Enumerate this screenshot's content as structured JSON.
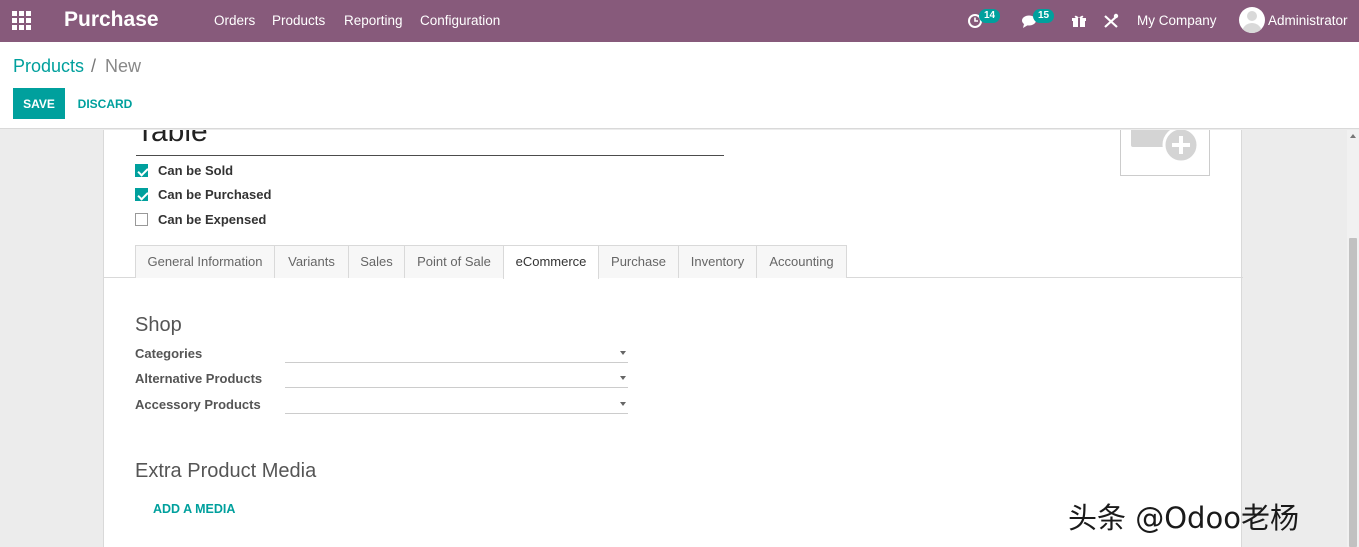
{
  "navbar": {
    "app_title": "Purchase",
    "menu": [
      "Orders",
      "Products",
      "Reporting",
      "Configuration"
    ],
    "activity_count": "14",
    "messages_count": "15",
    "company": "My Company",
    "user": "Administrator",
    "color": "#875a7b"
  },
  "breadcrumb": {
    "parent": "Products",
    "separator": "/",
    "current": "New"
  },
  "actions": {
    "save": "SAVE",
    "discard": "DISCARD"
  },
  "product": {
    "name": "Table",
    "options": [
      {
        "label": "Can be Sold",
        "checked": true
      },
      {
        "label": "Can be Purchased",
        "checked": true
      },
      {
        "label": "Can be Expensed",
        "checked": false
      }
    ]
  },
  "tabs": [
    "General Information",
    "Variants",
    "Sales",
    "Point of Sale",
    "eCommerce",
    "Purchase",
    "Inventory",
    "Accounting"
  ],
  "active_tab": "eCommerce",
  "shop": {
    "title": "Shop",
    "fields": [
      {
        "label": "Categories",
        "value": ""
      },
      {
        "label": "Alternative Products",
        "value": ""
      },
      {
        "label": "Accessory Products",
        "value": ""
      }
    ]
  },
  "media": {
    "title": "Extra Product Media",
    "add_label": "ADD A MEDIA"
  },
  "watermark": "头条 @Odoo老杨",
  "accent_color": "#00a09d"
}
